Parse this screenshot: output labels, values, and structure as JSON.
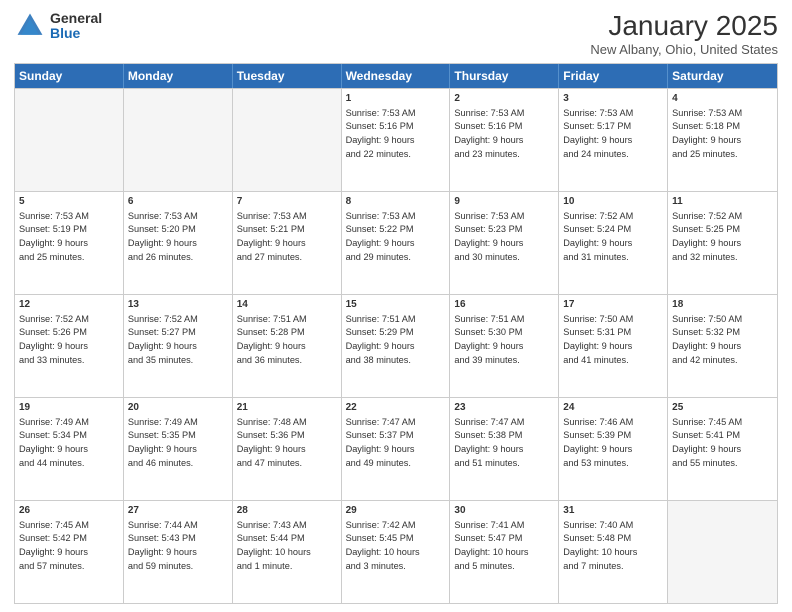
{
  "logo": {
    "general": "General",
    "blue": "Blue"
  },
  "header": {
    "title": "January 2025",
    "subtitle": "New Albany, Ohio, United States"
  },
  "days": [
    "Sunday",
    "Monday",
    "Tuesday",
    "Wednesday",
    "Thursday",
    "Friday",
    "Saturday"
  ],
  "rows": [
    [
      {
        "day": "",
        "text": "",
        "empty": true
      },
      {
        "day": "",
        "text": "",
        "empty": true
      },
      {
        "day": "",
        "text": "",
        "empty": true
      },
      {
        "day": "1",
        "text": "Sunrise: 7:53 AM\nSunset: 5:16 PM\nDaylight: 9 hours\nand 22 minutes."
      },
      {
        "day": "2",
        "text": "Sunrise: 7:53 AM\nSunset: 5:16 PM\nDaylight: 9 hours\nand 23 minutes."
      },
      {
        "day": "3",
        "text": "Sunrise: 7:53 AM\nSunset: 5:17 PM\nDaylight: 9 hours\nand 24 minutes."
      },
      {
        "day": "4",
        "text": "Sunrise: 7:53 AM\nSunset: 5:18 PM\nDaylight: 9 hours\nand 25 minutes."
      }
    ],
    [
      {
        "day": "5",
        "text": "Sunrise: 7:53 AM\nSunset: 5:19 PM\nDaylight: 9 hours\nand 25 minutes."
      },
      {
        "day": "6",
        "text": "Sunrise: 7:53 AM\nSunset: 5:20 PM\nDaylight: 9 hours\nand 26 minutes."
      },
      {
        "day": "7",
        "text": "Sunrise: 7:53 AM\nSunset: 5:21 PM\nDaylight: 9 hours\nand 27 minutes."
      },
      {
        "day": "8",
        "text": "Sunrise: 7:53 AM\nSunset: 5:22 PM\nDaylight: 9 hours\nand 29 minutes."
      },
      {
        "day": "9",
        "text": "Sunrise: 7:53 AM\nSunset: 5:23 PM\nDaylight: 9 hours\nand 30 minutes."
      },
      {
        "day": "10",
        "text": "Sunrise: 7:52 AM\nSunset: 5:24 PM\nDaylight: 9 hours\nand 31 minutes."
      },
      {
        "day": "11",
        "text": "Sunrise: 7:52 AM\nSunset: 5:25 PM\nDaylight: 9 hours\nand 32 minutes."
      }
    ],
    [
      {
        "day": "12",
        "text": "Sunrise: 7:52 AM\nSunset: 5:26 PM\nDaylight: 9 hours\nand 33 minutes."
      },
      {
        "day": "13",
        "text": "Sunrise: 7:52 AM\nSunset: 5:27 PM\nDaylight: 9 hours\nand 35 minutes."
      },
      {
        "day": "14",
        "text": "Sunrise: 7:51 AM\nSunset: 5:28 PM\nDaylight: 9 hours\nand 36 minutes."
      },
      {
        "day": "15",
        "text": "Sunrise: 7:51 AM\nSunset: 5:29 PM\nDaylight: 9 hours\nand 38 minutes."
      },
      {
        "day": "16",
        "text": "Sunrise: 7:51 AM\nSunset: 5:30 PM\nDaylight: 9 hours\nand 39 minutes."
      },
      {
        "day": "17",
        "text": "Sunrise: 7:50 AM\nSunset: 5:31 PM\nDaylight: 9 hours\nand 41 minutes."
      },
      {
        "day": "18",
        "text": "Sunrise: 7:50 AM\nSunset: 5:32 PM\nDaylight: 9 hours\nand 42 minutes."
      }
    ],
    [
      {
        "day": "19",
        "text": "Sunrise: 7:49 AM\nSunset: 5:34 PM\nDaylight: 9 hours\nand 44 minutes."
      },
      {
        "day": "20",
        "text": "Sunrise: 7:49 AM\nSunset: 5:35 PM\nDaylight: 9 hours\nand 46 minutes."
      },
      {
        "day": "21",
        "text": "Sunrise: 7:48 AM\nSunset: 5:36 PM\nDaylight: 9 hours\nand 47 minutes."
      },
      {
        "day": "22",
        "text": "Sunrise: 7:47 AM\nSunset: 5:37 PM\nDaylight: 9 hours\nand 49 minutes."
      },
      {
        "day": "23",
        "text": "Sunrise: 7:47 AM\nSunset: 5:38 PM\nDaylight: 9 hours\nand 51 minutes."
      },
      {
        "day": "24",
        "text": "Sunrise: 7:46 AM\nSunset: 5:39 PM\nDaylight: 9 hours\nand 53 minutes."
      },
      {
        "day": "25",
        "text": "Sunrise: 7:45 AM\nSunset: 5:41 PM\nDaylight: 9 hours\nand 55 minutes."
      }
    ],
    [
      {
        "day": "26",
        "text": "Sunrise: 7:45 AM\nSunset: 5:42 PM\nDaylight: 9 hours\nand 57 minutes."
      },
      {
        "day": "27",
        "text": "Sunrise: 7:44 AM\nSunset: 5:43 PM\nDaylight: 9 hours\nand 59 minutes."
      },
      {
        "day": "28",
        "text": "Sunrise: 7:43 AM\nSunset: 5:44 PM\nDaylight: 10 hours\nand 1 minute."
      },
      {
        "day": "29",
        "text": "Sunrise: 7:42 AM\nSunset: 5:45 PM\nDaylight: 10 hours\nand 3 minutes."
      },
      {
        "day": "30",
        "text": "Sunrise: 7:41 AM\nSunset: 5:47 PM\nDaylight: 10 hours\nand 5 minutes."
      },
      {
        "day": "31",
        "text": "Sunrise: 7:40 AM\nSunset: 5:48 PM\nDaylight: 10 hours\nand 7 minutes."
      },
      {
        "day": "",
        "text": "",
        "empty": true
      }
    ]
  ]
}
